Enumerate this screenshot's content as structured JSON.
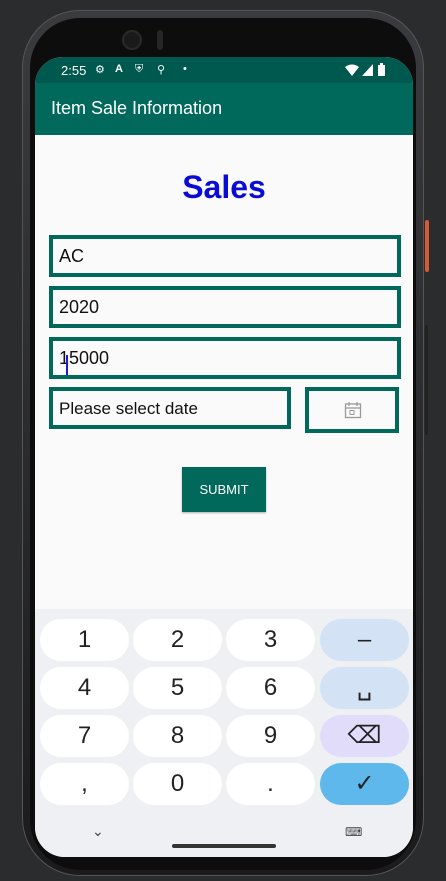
{
  "status_bar": {
    "time": "2:55",
    "icons": [
      "gear-icon",
      "a-icon",
      "shield-icon",
      "nav-icon",
      "dot-icon",
      "wifi-icon",
      "signal-icon",
      "battery-icon"
    ]
  },
  "app_bar": {
    "title": "Item Sale Information"
  },
  "form": {
    "heading": "Sales",
    "item_value": "AC",
    "year_value": "2020",
    "amount_value": "15000",
    "date_placeholder": "Please select date",
    "submit_label": "SUBMIT"
  },
  "keyboard": {
    "row1": [
      "1",
      "2",
      "3",
      "–"
    ],
    "row2": [
      "4",
      "5",
      "6",
      "␣"
    ],
    "row3": [
      "7",
      "8",
      "9",
      "⌫"
    ],
    "row4": [
      ",",
      "0",
      ".",
      "✓"
    ]
  },
  "nav": {
    "hide_glyph": "⌄",
    "keyboard_glyph": "⌨"
  },
  "colors": {
    "accent": "#00695c",
    "heading": "#0b0bd6",
    "status_bar": "#00594f"
  }
}
